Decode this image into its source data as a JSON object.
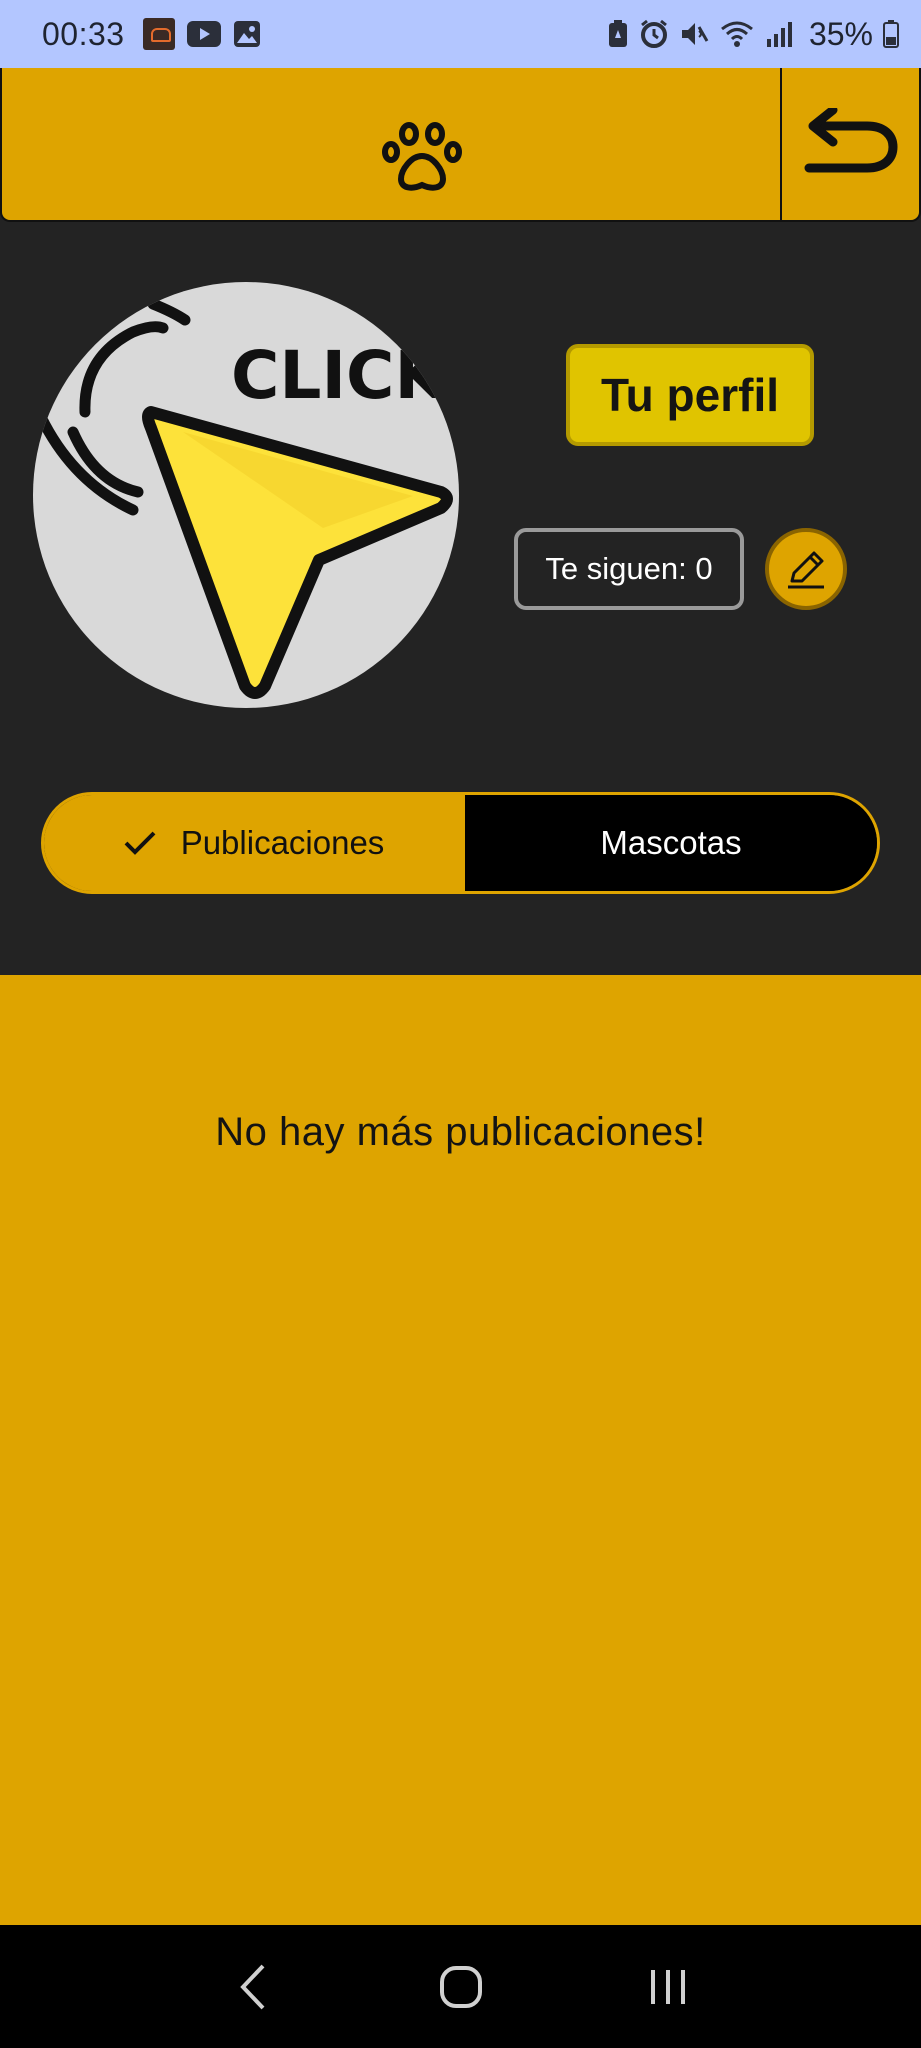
{
  "status_bar": {
    "time": "00:33",
    "battery": "35%",
    "notification_icons": [
      "app-notification-icon",
      "youtube-icon",
      "gallery-icon"
    ],
    "system_icons": [
      "battery-saver-icon",
      "alarm-icon",
      "mute-icon",
      "wifi-icon",
      "signal-icon",
      "battery-icon"
    ]
  },
  "app_bar": {
    "center_icon": "paw-icon",
    "back_icon": "undo-arrow-icon"
  },
  "profile": {
    "avatar_text": "CLICK",
    "title_button": "Tu perfil",
    "followers": "Te siguen: 0",
    "edit_icon": "pencil-icon"
  },
  "tabs": [
    {
      "label": "Publicaciones",
      "selected": true,
      "icon": "check-icon"
    },
    {
      "label": "Mascotas",
      "selected": false
    }
  ],
  "content": {
    "empty_message": "No hay más publicaciones!"
  },
  "nav_bar": {
    "icons": [
      "back-nav-icon",
      "home-nav-icon",
      "recents-nav-icon"
    ]
  },
  "colors": {
    "primary": "#dea400",
    "background": "#232323",
    "button_yellow": "#e0c400",
    "status_bar": "#b3c6ff"
  }
}
